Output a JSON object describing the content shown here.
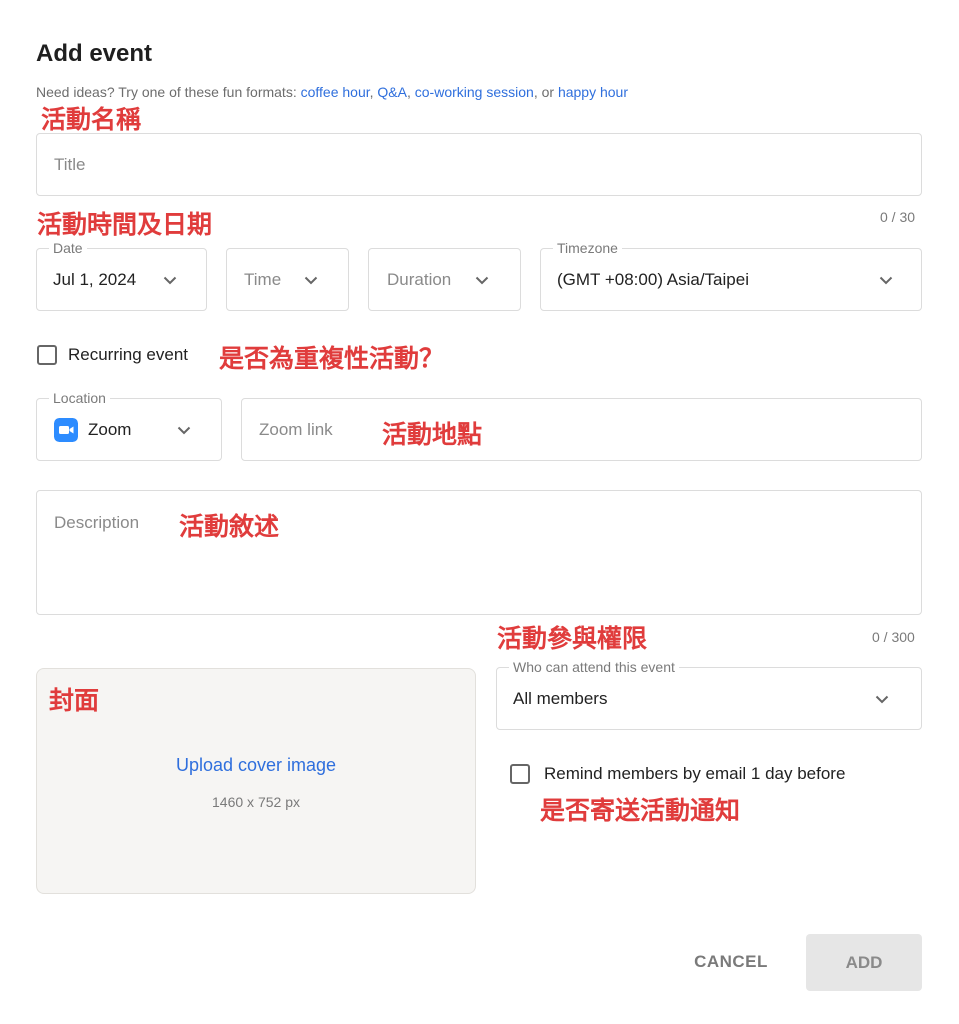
{
  "header": {
    "title": "Add event",
    "ideas_prefix": "Need ideas? Try one of these fun formats: ",
    "ideas_links": [
      "coffee hour",
      "Q&A",
      "co-working session",
      "happy hour"
    ],
    "sep1": ", ",
    "sep2": ", ",
    "sep3": ", or "
  },
  "title_field": {
    "placeholder": "Title",
    "counter": "0 / 30"
  },
  "date": {
    "legend": "Date",
    "value": "Jul 1, 2024"
  },
  "time": {
    "placeholder": "Time"
  },
  "duration": {
    "placeholder": "Duration"
  },
  "timezone": {
    "legend": "Timezone",
    "value": "(GMT +08:00) Asia/Taipei"
  },
  "recurring": {
    "label": "Recurring event"
  },
  "location": {
    "legend": "Location",
    "value": "Zoom",
    "icon": "zoom-icon",
    "accent": "#2d8cff"
  },
  "zoom_link": {
    "placeholder": "Zoom link"
  },
  "description": {
    "placeholder": "Description",
    "counter": "0 / 300"
  },
  "cover": {
    "upload_label": "Upload cover image",
    "dimensions": "1460 x 752 px"
  },
  "attend": {
    "legend": "Who can attend this event",
    "value": "All members"
  },
  "remind": {
    "label": "Remind members by email 1 day before"
  },
  "buttons": {
    "cancel": "CANCEL",
    "add": "ADD"
  },
  "annotations": {
    "event_name": "活動名稱",
    "event_time_date": "活動時間及日期",
    "recurring_q": "是否為重複性活動？",
    "event_location": "活動地點",
    "event_description": "活動敘述",
    "event_permission": "活動參與權限",
    "cover": "封面",
    "send_notice": "是否寄送活動通知"
  },
  "colors": {
    "link": "#2f6fdd",
    "annotation": "#e03c3c",
    "add_bg": "#e6e6e6"
  }
}
